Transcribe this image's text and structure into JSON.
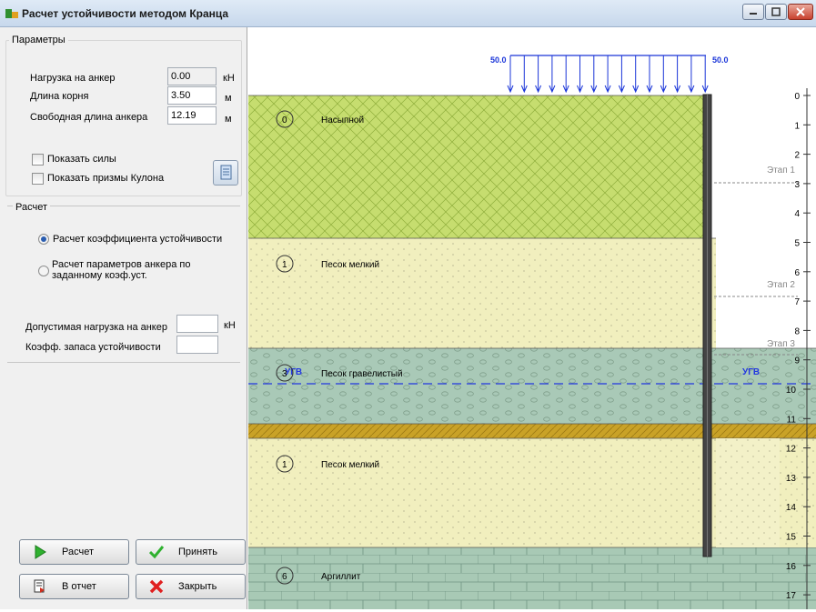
{
  "window": {
    "title": "Расчет устойчивости методом Кранца"
  },
  "params": {
    "title": "Параметры",
    "anchor_load": {
      "label": "Нагрузка на анкер",
      "value": "0.00",
      "unit": "кН"
    },
    "root_length": {
      "label": "Длина корня",
      "value": "3.50",
      "unit": "м"
    },
    "free_length": {
      "label": "Свободная длина анкера",
      "value": "12.19",
      "unit": "м"
    },
    "show_forces": "Показать силы",
    "show_prisms": "Показать призмы Кулона"
  },
  "calc": {
    "title": "Расчет",
    "mode_coef": "Расчет коэффициента устойчивости",
    "mode_params": "Расчет параметров анкера по заданному коэф.уст.",
    "allowed_load": {
      "label": "Допустимая нагрузка на анкер",
      "value": "",
      "unit": "кН"
    },
    "safety_factor": {
      "label": "Коэфф. запаса устойчивости",
      "value": ""
    }
  },
  "buttons": {
    "calc": "Расчет",
    "accept": "Принять",
    "report": "В отчет",
    "close": "Закрыть"
  },
  "diagram": {
    "load_left": "50.0",
    "load_right": "50.0",
    "water_label": "УГВ",
    "layers": [
      {
        "num": "0",
        "name": "Насыпной"
      },
      {
        "num": "1",
        "name": "Песок мелкий"
      },
      {
        "num": "3",
        "name": "Песок гравелистый"
      },
      {
        "num": "1",
        "name": "Песок мелкий"
      },
      {
        "num": "6",
        "name": "Аргиллит"
      }
    ],
    "stages": [
      "Этап 1",
      "Этап 2",
      "Этап 3"
    ],
    "depth_ticks": [
      "0",
      "1",
      "2",
      "3",
      "4",
      "5",
      "6",
      "7",
      "8",
      "9",
      "10",
      "11",
      "12",
      "13",
      "14",
      "15",
      "16",
      "17"
    ]
  },
  "colors": {
    "fill_layer": "#c6dd6f",
    "sand_fine": "#f1efbe",
    "gravel_sand": "#a9c9b7",
    "clay_band": "#c9a227",
    "argillite": "#a8c9b5",
    "load_arrows": "#1a35d8",
    "water_line": "#2237e0"
  }
}
